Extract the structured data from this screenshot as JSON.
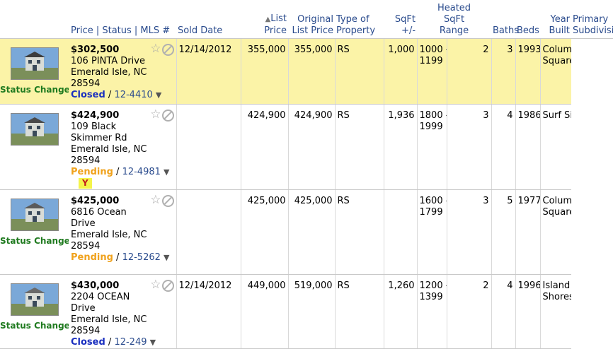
{
  "columns": {
    "price_status_mls": "Price | Status | MLS #",
    "sold_date": "Sold Date",
    "sort_arrow": "▲",
    "list_price_1": "List",
    "list_price_2": "Price",
    "orig_price_1": "Original",
    "orig_price_2": "List Price",
    "type_1": "Type of",
    "type_2": "Property",
    "sqft": "SqFt\n+/-",
    "heated_1": "Heated",
    "heated_2": "SqFt",
    "heated_3": "Range",
    "baths": "Baths",
    "beds": "Beds",
    "year_1": "Year",
    "year_2": "Built",
    "subdiv_1": "Primary",
    "subdiv_2": "Subdivision"
  },
  "rows": [
    {
      "highlight": true,
      "status_change": "Status Change",
      "price": "$302,500",
      "address": "106 PINTA Drive\nEmerald Isle, NC\n28594",
      "status": "Closed",
      "status_class": "closed",
      "mls": "12-4410",
      "badge": "",
      "sold_date": "12/14/2012",
      "list_price": "355,000",
      "orig_price": "355,000",
      "type": "RS",
      "sqft": "1,000",
      "range": "1000 –\n1199",
      "baths": "2",
      "beds": "3",
      "year": "1993",
      "subdivision": "Columbus\nSquare"
    },
    {
      "highlight": false,
      "status_change": "",
      "price": "$424,900",
      "address": "109 Black\nSkimmer Rd\nEmerald Isle, NC\n28594",
      "status": "Pending",
      "status_class": "pending",
      "mls": "12-4981",
      "badge": "Y",
      "sold_date": "",
      "list_price": "424,900",
      "orig_price": "424,900",
      "type": "RS",
      "sqft": "1,936",
      "range": "1800 –\n1999",
      "baths": "3",
      "beds": "4",
      "year": "1986",
      "subdivision": "Surf Side"
    },
    {
      "highlight": false,
      "status_change": "Status Change",
      "price": "$425,000",
      "address": "6816 Ocean\nDrive\nEmerald Isle, NC\n28594",
      "status": "Pending",
      "status_class": "pending",
      "mls": "12-5262",
      "badge": "",
      "sold_date": "",
      "list_price": "425,000",
      "orig_price": "425,000",
      "type": "RS",
      "sqft": "",
      "range": "1600 –\n1799",
      "baths": "3",
      "beds": "5",
      "year": "1977",
      "subdivision": "Columbus\nSquare"
    },
    {
      "highlight": false,
      "status_change": "Status Change",
      "price": "$430,000",
      "address": "2204 OCEAN\nDrive\nEmerald Isle, NC\n28594",
      "status": "Closed",
      "status_class": "closed",
      "mls": "12-249",
      "badge": "",
      "sold_date": "12/14/2012",
      "list_price": "449,000",
      "orig_price": "519,000",
      "type": "RS",
      "sqft": "1,260",
      "range": "1200 –\n1399",
      "baths": "2",
      "beds": "4",
      "year": "1996",
      "subdivision": "Island\nShores"
    }
  ],
  "icons": {
    "favorite": "star-outline-icon",
    "hide": "cancel-circle-icon",
    "dropdown": "caret-down-icon"
  },
  "colors": {
    "header_text": "#2a4b8d",
    "highlight_row": "#fbf3a7",
    "status_change": "#1f7a1f",
    "closed": "#1a2fbf",
    "pending": "#f0a21c",
    "badge_bg": "#f4f44a",
    "badge_text": "#c21a1a"
  }
}
